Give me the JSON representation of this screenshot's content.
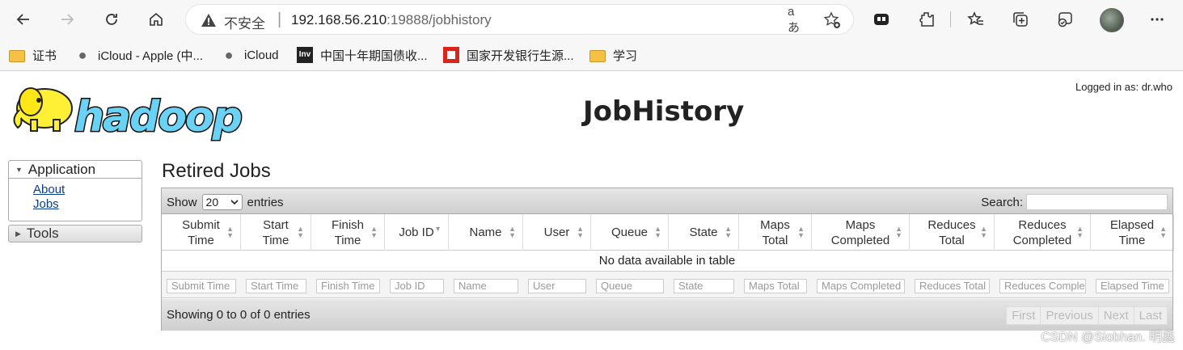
{
  "browser": {
    "security_text": "不安全",
    "url_host": "192.168.56.210",
    "url_rest": ":19888/jobhistory",
    "read_aloud_label": "aあ",
    "bookmarks": [
      {
        "label": "证书",
        "icon": "folder-icon"
      },
      {
        "label": "iCloud - Apple (中...",
        "icon": "apple-icon"
      },
      {
        "label": "iCloud",
        "icon": "apple-icon"
      },
      {
        "label": "中国十年期国债收...",
        "icon": "investing-icon"
      },
      {
        "label": "国家开发银行生源...",
        "icon": "cdb-icon"
      },
      {
        "label": "学习",
        "icon": "folder-icon"
      }
    ],
    "inv_badge": "Inv"
  },
  "page": {
    "logged_in": "Logged in as: dr.who",
    "title": "JobHistory",
    "logo_text": "hadoop"
  },
  "nav": {
    "application_label": "Application",
    "links": [
      "About",
      "Jobs"
    ],
    "tools_label": "Tools"
  },
  "table": {
    "section_title": "Retired Jobs",
    "show_label": "Show",
    "length_value": "20",
    "entries_label": "entries",
    "search_label": "Search:",
    "columns": [
      "Submit Time",
      "Start Time",
      "Finish Time",
      "Job ID",
      "Name",
      "User",
      "Queue",
      "State",
      "Maps Total",
      "Maps Completed",
      "Reduces Total",
      "Reduces Completed",
      "Elapsed Time"
    ],
    "header_lines": [
      [
        "Submit",
        "Time"
      ],
      [
        "Start",
        "Time"
      ],
      [
        "Finish",
        "Time"
      ],
      [
        "Job ID",
        ""
      ],
      [
        "Name",
        ""
      ],
      [
        "User",
        ""
      ],
      [
        "Queue",
        ""
      ],
      [
        "State",
        ""
      ],
      [
        "Maps",
        "Total"
      ],
      [
        "Maps",
        "Completed"
      ],
      [
        "Reduces",
        "Total"
      ],
      [
        "Reduces",
        "Completed"
      ],
      [
        "Elapsed",
        "Time"
      ]
    ],
    "footer_filters": [
      "Submit Time",
      "Start Time",
      "Finish Time",
      "Job ID",
      "Name",
      "User",
      "Queue",
      "State",
      "Maps Total",
      "Maps Completed",
      "Reduces Total",
      "Reduces Comple",
      "Elapsed Time"
    ],
    "empty_message": "No data available in table",
    "info": "Showing 0 to 0 of 0 entries",
    "pager": [
      "First",
      "Previous",
      "Next",
      "Last"
    ]
  },
  "watermark": "CSDN @Siobhan. 明鑫"
}
